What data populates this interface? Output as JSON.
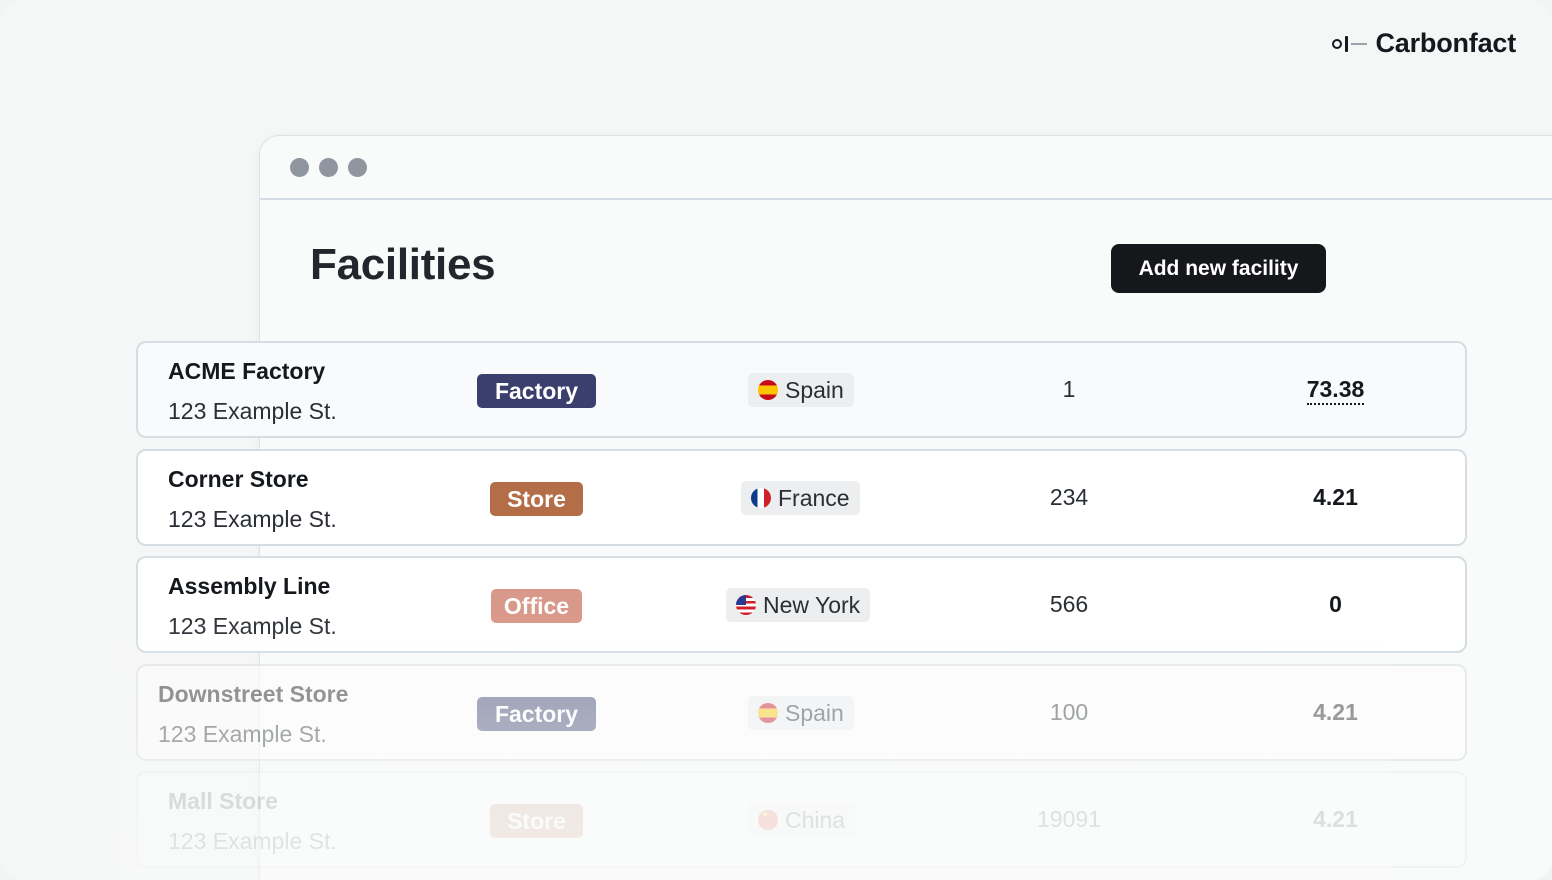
{
  "brand": {
    "name": "Carbonfact"
  },
  "window": {
    "dots": [
      "dot",
      "dot",
      "dot"
    ]
  },
  "page": {
    "title": "Facilities",
    "add_button": "Add new facility"
  },
  "facilities": [
    {
      "name": "ACME Factory",
      "address": "123 Example St.",
      "type": "Factory",
      "location": "Spain",
      "flag": "spain-flag-icon",
      "count": "1",
      "score": "73.38"
    },
    {
      "name": "Corner Store",
      "address": "123 Example St.",
      "type": "Store",
      "location": "France",
      "flag": "france-flag-icon",
      "count": "234",
      "score": "4.21"
    },
    {
      "name": "Assembly Line",
      "address": "123 Example St.",
      "type": "Office",
      "location": "New York",
      "flag": "usa-flag-icon",
      "count": "566",
      "score": "0"
    },
    {
      "name": "Downstreet Store",
      "address": "123 Example St.",
      "type": "Factory",
      "location": "Spain",
      "flag": "spain-flag-icon",
      "count": "100",
      "score": "4.21"
    },
    {
      "name": "Mall Store",
      "address": "123 Example St.",
      "type": "Store",
      "location": "China",
      "flag": "china-flag-icon",
      "count": "19091",
      "score": "4.21"
    }
  ],
  "colors": {
    "factory_badge": "#3a3f6e",
    "store_badge": "#b36e47",
    "office_badge": "#d9998a",
    "button": "#15171a"
  }
}
